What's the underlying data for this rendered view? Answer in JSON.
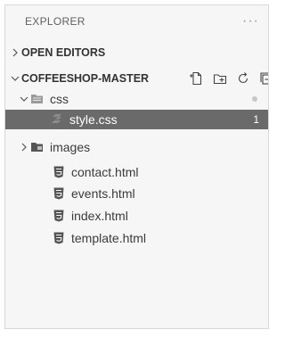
{
  "explorer": {
    "title": "EXPLORER",
    "more_label": "···"
  },
  "open_editors": {
    "label": "OPEN EDITORS"
  },
  "project": {
    "label": "COFFEESHOP-MASTER",
    "actions": [
      "new-file-icon",
      "new-folder-icon",
      "refresh-icon",
      "collapse-all-icon"
    ]
  },
  "tree": {
    "css_folder": {
      "label": "css",
      "icon": "folder-open-icon"
    },
    "style_file": {
      "label": "style.css",
      "badge": "1",
      "icon": "css-file-icon"
    },
    "images_folder": {
      "label": "images",
      "icon": "folder-icon"
    },
    "files": [
      {
        "label": "contact.html",
        "icon": "html-file-icon"
      },
      {
        "label": "events.html",
        "icon": "html-file-icon"
      },
      {
        "label": "index.html",
        "icon": "html-file-icon"
      },
      {
        "label": "template.html",
        "icon": "html-file-icon"
      }
    ]
  },
  "colors": {
    "panel_background": "#f6f6f6",
    "selected_background": "#6a6a6a",
    "selected_text": "#ffffff",
    "text": "#3b3b3b"
  }
}
